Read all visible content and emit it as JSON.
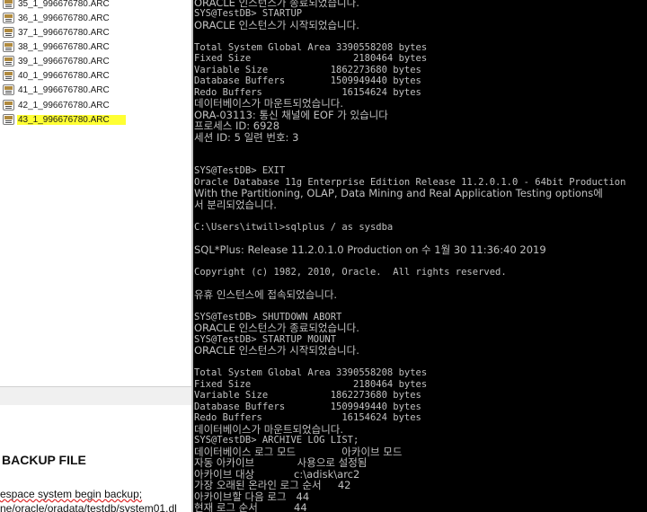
{
  "explorer": {
    "files": [
      "35_1_996676780.ARC",
      "36_1_996676780.ARC",
      "37_1_996676780.ARC",
      "38_1_996676780.ARC",
      "39_1_996676780.ARC",
      "40_1_996676780.ARC",
      "41_1_996676780.ARC",
      "42_1_996676780.ARC",
      "43_1_996676780.ARC"
    ],
    "file_icon": "archive-file-icon",
    "selected_highlight": "#ffff33"
  },
  "document": {
    "heading": "BACKUP FILE",
    "line1_prefix": "espace system begin backup;",
    "line2": "ne/oracle/oradata/testdb/system01.dl"
  },
  "console": {
    "lines": [
      "ORACLE 인스턴스가 종료되었습니다.",
      "SYS@TestDB> STARTUP",
      "ORACLE 인스턴스가 시작되었습니다.",
      "",
      "Total System Global Area 3390558208 bytes",
      "Fixed Size                  2180464 bytes",
      "Variable Size           1862273680 bytes",
      "Database Buffers        1509949440 bytes",
      "Redo Buffers              16154624 bytes",
      "데이터베이스가 마운트되었습니다.",
      "ORA-03113: 통신 채널에 EOF 가 있습니다",
      "프로세스 ID: 6928",
      "세션 ID: 5 일련 번호: 3",
      "",
      "",
      "SYS@TestDB> EXIT",
      "Oracle Database 11g Enterprise Edition Release 11.2.0.1.0 - 64bit Production",
      "With the Partitioning, OLAP, Data Mining and Real Application Testing options에",
      "서 분리되었습니다.",
      "",
      "C:\\Users\\itwill>sqlplus / as sysdba",
      "",
      "SQL*Plus: Release 11.2.0.1.0 Production on 수 1월 30 11:36:40 2019",
      "",
      "Copyright (c) 1982, 2010, Oracle.  All rights reserved.",
      "",
      "유휴 인스턴스에 접속되었습니다.",
      "",
      "SYS@TestDB> SHUTDOWN ABORT",
      "ORACLE 인스턴스가 종료되었습니다.",
      "SYS@TestDB> STARTUP MOUNT",
      "ORACLE 인스턴스가 시작되었습니다.",
      "",
      "Total System Global Area 3390558208 bytes",
      "Fixed Size                  2180464 bytes",
      "Variable Size           1862273680 bytes",
      "Database Buffers        1509949440 bytes",
      "Redo Buffers              16154624 bytes",
      "데이터베이스가 마운트되었습니다.",
      "SYS@TestDB> ARCHIVE LOG LIST;",
      "데이터베이스 로그 모드              아카이브 모드",
      "자동 아카이브             사용으로 설정됨",
      "아카이브 대상            c:\\adisk\\arc2",
      "가장 오래된 온라인 로그 순서     42",
      "아카이브할 다음 로그   44",
      "현재 로그 순서           44"
    ],
    "text_color": "#c0c0c0",
    "background": "#000000"
  }
}
